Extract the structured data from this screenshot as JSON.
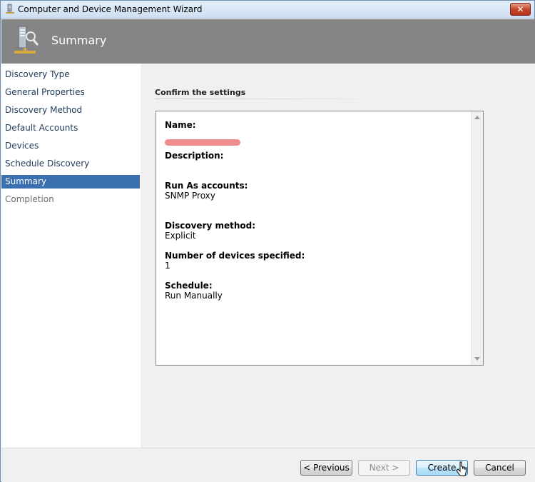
{
  "window": {
    "title": "Computer and Device Management Wizard",
    "close_label": "✕"
  },
  "header": {
    "title": "Summary"
  },
  "nav": {
    "items": [
      {
        "label": "Discovery Type"
      },
      {
        "label": "General Properties"
      },
      {
        "label": "Discovery Method"
      },
      {
        "label": "Default Accounts"
      },
      {
        "label": "Devices"
      },
      {
        "label": "Schedule Discovery"
      },
      {
        "label": "Summary"
      },
      {
        "label": "Completion"
      }
    ]
  },
  "content": {
    "section_title": "Confirm the settings",
    "fields": {
      "name_label": "Name:",
      "description_label": "Description:",
      "runas_label": "Run As accounts:",
      "runas_value": "SNMP Proxy",
      "method_label": "Discovery method:",
      "method_value": "Explicit",
      "devices_label": "Number of devices specified:",
      "devices_value": "1",
      "schedule_label": "Schedule:",
      "schedule_value": "Run Manually"
    }
  },
  "footer": {
    "previous_label": "< Previous",
    "next_label": "Next >",
    "create_label": "Create",
    "cancel_label": "Cancel"
  },
  "colors": {
    "accent": "#3a70b0",
    "header_bg": "#858585",
    "redaction": "#f08080"
  }
}
